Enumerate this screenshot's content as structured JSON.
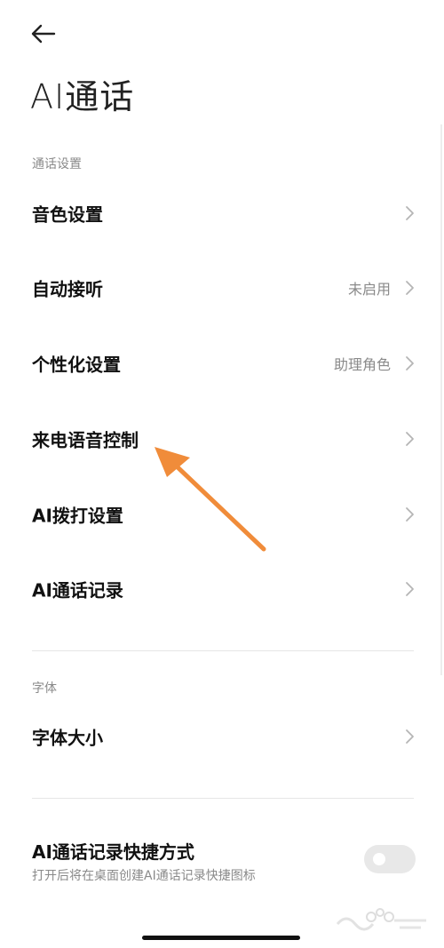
{
  "header": {
    "title": "AI通话"
  },
  "sections": [
    {
      "header": "通话设置",
      "items": [
        {
          "label": "音色设置",
          "value": ""
        },
        {
          "label": "自动接听",
          "value": "未启用"
        },
        {
          "label": "个性化设置",
          "value": "助理角色"
        },
        {
          "label": "来电语音控制",
          "value": ""
        },
        {
          "label": "AI拨打设置",
          "value": ""
        },
        {
          "label": "AI通话记录",
          "value": ""
        }
      ]
    },
    {
      "header": "字体",
      "items": [
        {
          "label": "字体大小",
          "value": ""
        }
      ]
    }
  ],
  "shortcut": {
    "title": "AI通话记录快捷方式",
    "description": "打开后将在桌面创建AI通话记录快捷图标",
    "enabled": false
  },
  "colors": {
    "annotation_arrow": "#f08c3a",
    "secondary_text": "#8a8a8a",
    "toggle_off": "#e8e8e8"
  },
  "icons": {
    "back": "arrow-left-icon",
    "chevron": "chevron-right-icon"
  }
}
